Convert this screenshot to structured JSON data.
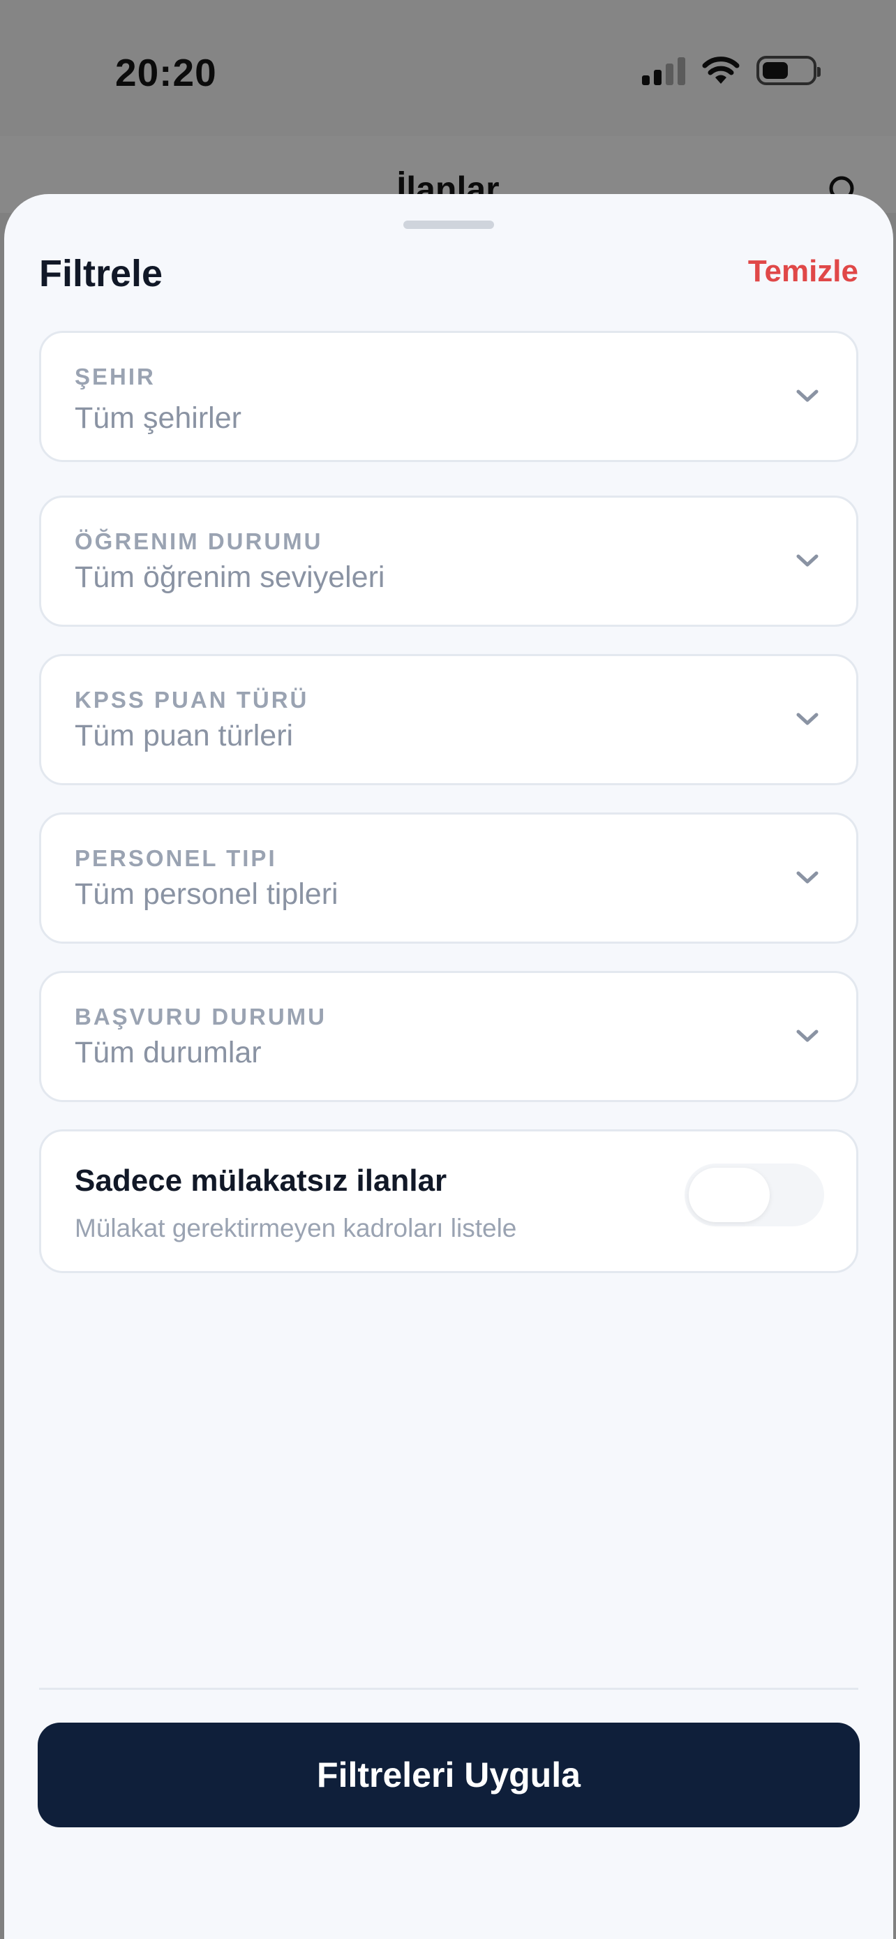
{
  "status_bar": {
    "time": "20:20",
    "icons": [
      "cellular-signal-icon",
      "wifi-icon",
      "battery-icon"
    ]
  },
  "background_screen": {
    "title": "İlanlar",
    "icon": "search-icon"
  },
  "sheet": {
    "title": "Filtrele",
    "clear_label": "Temizle",
    "filters": [
      {
        "label": "ŞEHIR",
        "value": "Tüm şehirler"
      },
      {
        "label": "ÖĞRENIM DURUMU",
        "value": "Tüm öğrenim seviyeleri"
      },
      {
        "label": "KPSS PUAN TÜRÜ",
        "value": "Tüm puan türleri"
      },
      {
        "label": "PERSONEL TIPI",
        "value": "Tüm personel tipleri"
      },
      {
        "label": "BAŞVURU DURUMU",
        "value": "Tüm durumlar"
      }
    ],
    "toggle": {
      "title": "Sadece mülakatsız ilanlar",
      "subtitle": "Mülakat gerektirmeyen kadroları listele",
      "enabled": false
    },
    "apply_label": "Filtreleri Uygula"
  },
  "colors": {
    "accent_red": "#e04848",
    "primary_button": "#0f1f3a",
    "sheet_background": "#f6f8fc",
    "overlay_dim": "#808080"
  }
}
